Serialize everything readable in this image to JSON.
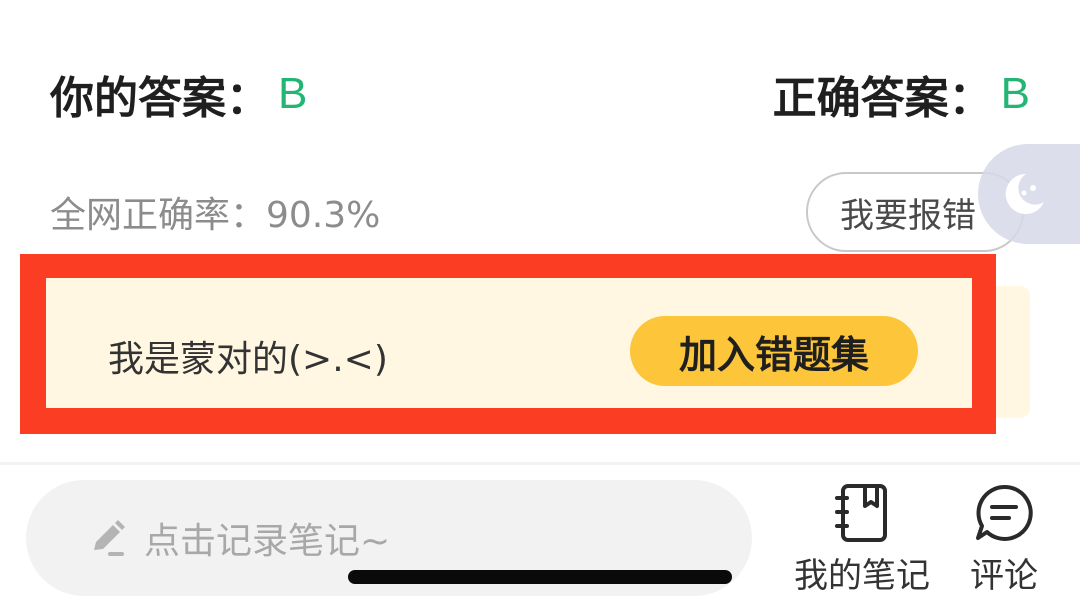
{
  "answers": {
    "your_label": "你的答案：",
    "your_value": "B",
    "correct_label": "正确答案：",
    "correct_value": "B",
    "value_color": "#22b573"
  },
  "stats": {
    "accuracy": "全网正确率：90.3%"
  },
  "report": {
    "label": "我要报错"
  },
  "night_mode": {
    "icon": "moon-icon"
  },
  "guess_banner": {
    "text": "我是蒙对的(>.<)",
    "button_label": "加入错题集",
    "highlight_color": "#fa3d23",
    "background_color": "#fff7e2",
    "button_color": "#fdc63a"
  },
  "bottom_bar": {
    "note_placeholder": "点击记录笔记~",
    "note_icon": "pencil-icon",
    "my_notes_label": "我的笔记",
    "my_notes_icon": "notebook-icon",
    "comments_label": "评论",
    "comments_icon": "comment-icon"
  }
}
